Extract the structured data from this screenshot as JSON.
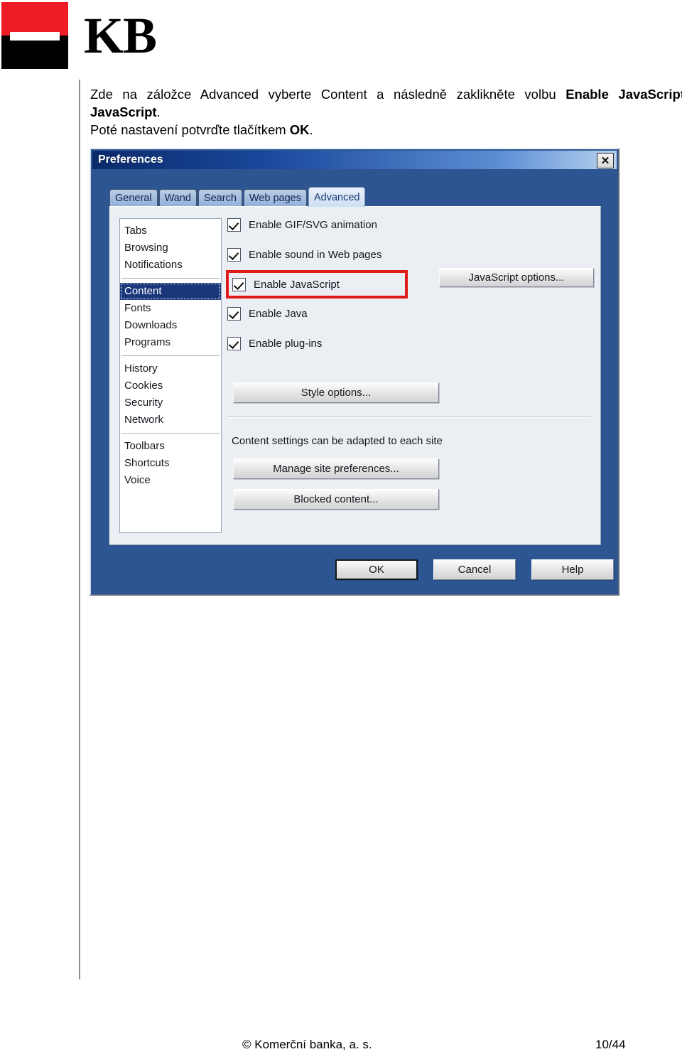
{
  "brand": {
    "logo_wordmark": "KB",
    "logo_name": "kb-logo",
    "colors": {
      "red": "#ee1c25",
      "black": "#000000"
    }
  },
  "instructions": {
    "line1_part1": "Zde na záložce Advanced vyberte Content a následně zaklikněte volbu ",
    "line1_bold": "Enable JavaScript",
    "line1_end": ".",
    "line2_part1": "Poté nastavení potvrďte tlačítkem ",
    "line2_bold": "OK",
    "line2_end": "."
  },
  "dialog": {
    "title": "Preferences",
    "close_label": "✕",
    "tabs": [
      {
        "label": "General",
        "active": false
      },
      {
        "label": "Wand",
        "active": false
      },
      {
        "label": "Search",
        "active": false
      },
      {
        "label": "Web pages",
        "active": false
      },
      {
        "label": "Advanced",
        "active": true
      }
    ],
    "sidebar": {
      "groups": [
        {
          "items": [
            {
              "label": "Tabs",
              "selected": false
            },
            {
              "label": "Browsing",
              "selected": false
            },
            {
              "label": "Notifications",
              "selected": false
            }
          ]
        },
        {
          "items": [
            {
              "label": "Content",
              "selected": true
            },
            {
              "label": "Fonts",
              "selected": false
            },
            {
              "label": "Downloads",
              "selected": false
            },
            {
              "label": "Programs",
              "selected": false
            }
          ]
        },
        {
          "items": [
            {
              "label": "History",
              "selected": false
            },
            {
              "label": "Cookies",
              "selected": false
            },
            {
              "label": "Security",
              "selected": false
            },
            {
              "label": "Network",
              "selected": false
            }
          ]
        },
        {
          "items": [
            {
              "label": "Toolbars",
              "selected": false
            },
            {
              "label": "Shortcuts",
              "selected": false
            },
            {
              "label": "Voice",
              "selected": false
            }
          ]
        }
      ]
    },
    "checkboxes": [
      {
        "label": "Enable GIF/SVG animation",
        "checked": true,
        "highlighted": false
      },
      {
        "label": "Enable sound in Web pages",
        "checked": true,
        "highlighted": false
      },
      {
        "label": "Enable JavaScript",
        "checked": true,
        "highlighted": true
      },
      {
        "label": "Enable Java",
        "checked": true,
        "highlighted": false
      },
      {
        "label": "Enable plug-ins",
        "checked": true,
        "highlighted": false
      }
    ],
    "buttons": {
      "javascript_options": "JavaScript options...",
      "style_options": "Style options...",
      "manage_site_preferences": "Manage site preferences...",
      "blocked_content": "Blocked content...",
      "ok": "OK",
      "cancel": "Cancel",
      "help": "Help"
    },
    "site_note": "Content settings can be adapted to each site",
    "highlight_color": "#e01a1a"
  },
  "footer": {
    "copyright": "© Komerční banka, a. s.",
    "page_number": "10/44"
  }
}
